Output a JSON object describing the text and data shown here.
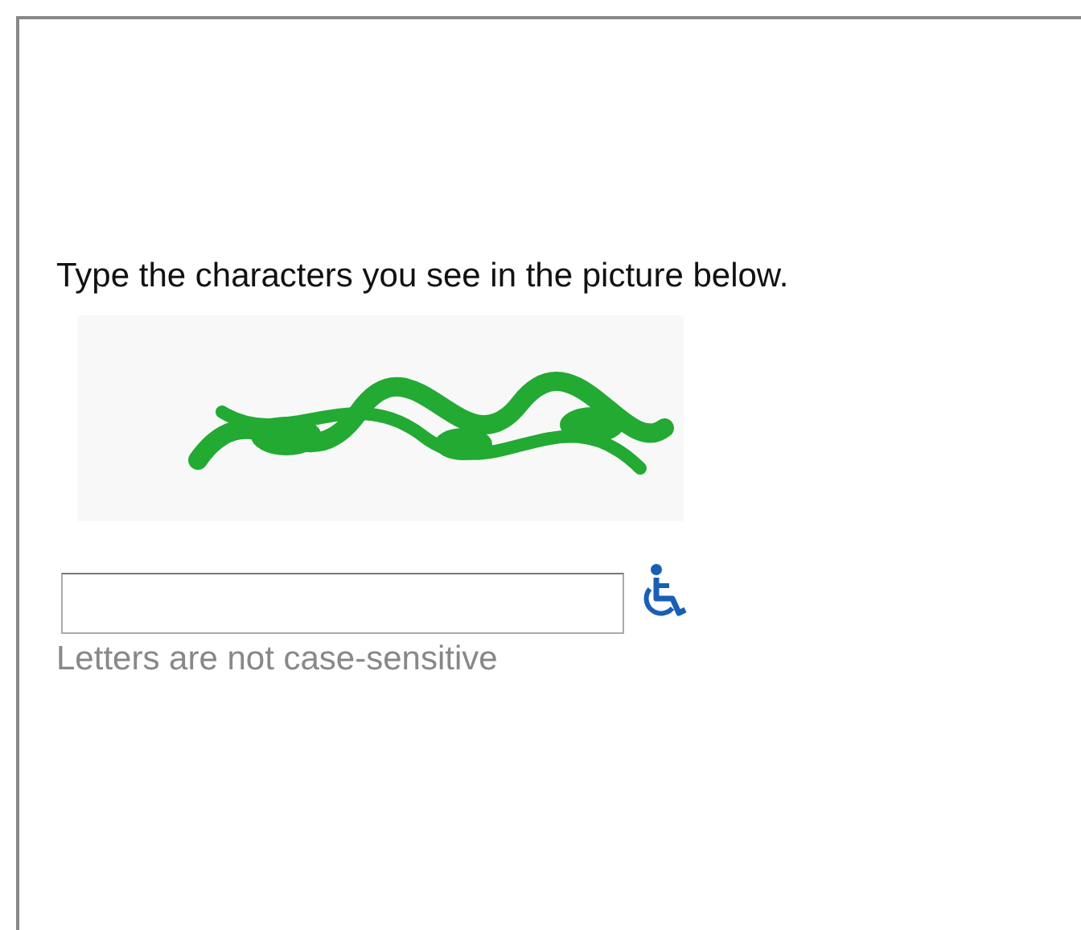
{
  "instruction": "Type the characters you see in the picture below.",
  "hint": "Letters are not case-sensitive"
}
